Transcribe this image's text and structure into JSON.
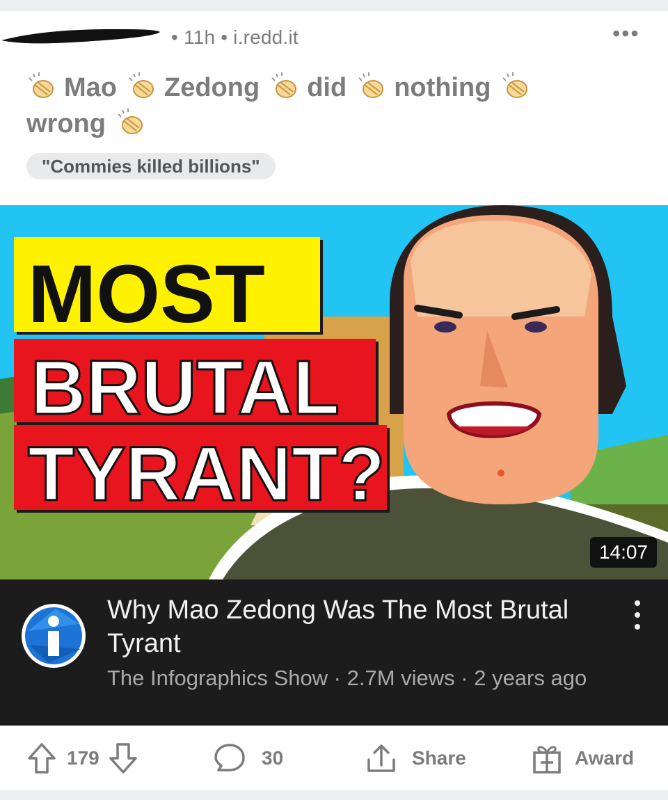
{
  "post": {
    "meta": "• 11h • i.redd.it",
    "more_label": "•••",
    "title_words": [
      "Mao",
      "Zedong",
      "did",
      "nothing",
      "wrong"
    ],
    "flair": "\"Commies killed billions\""
  },
  "thumbnail": {
    "line1": "MOST",
    "line2": "BRUTAL",
    "line3": "TYRANT?",
    "duration": "14:07"
  },
  "video": {
    "title": "Why Mao Zedong Was The Most Brutal Tyrant",
    "subtitle": "The Infographics Show · 2.7M views · 2 years ago",
    "channel_icon_letter": "i"
  },
  "actions": {
    "score": "179",
    "comments": "30",
    "share_label": "Share",
    "award_label": "Award"
  },
  "colors": {
    "sky": "#21c4f2",
    "red_banner": "#e8141e",
    "yellow_banner": "#fff200",
    "dark_panel": "#1c1c1c",
    "meta_gray": "#7c7c7c"
  }
}
